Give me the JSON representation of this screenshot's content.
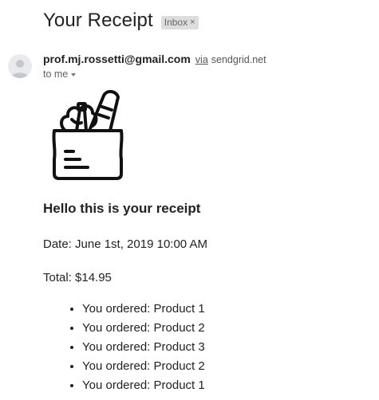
{
  "email": {
    "subject": "Your Receipt",
    "label": "Inbox",
    "label_close": "×",
    "sender": "prof.mj.rossetti@gmail.com",
    "via_label": "via",
    "via_domain": "sendgrid.net",
    "recipient": "to me"
  },
  "icons": {
    "avatar": "person-avatar-icon",
    "bag": "grocery-bag-icon",
    "caret": "caret-down-icon"
  },
  "receipt": {
    "heading": "Hello this is your receipt",
    "date": "Date: June 1st, 2019 10:00 AM",
    "total": "Total: $14.95",
    "items": [
      "You ordered: Product 1",
      "You ordered: Product 2",
      "You ordered: Product 3",
      "You ordered: Product 2",
      "You ordered: Product 1"
    ]
  }
}
